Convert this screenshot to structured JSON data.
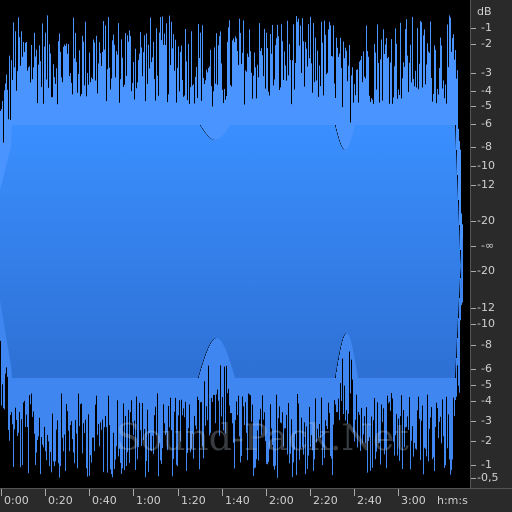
{
  "colors": {
    "waveform_top": "#3a8fff",
    "waveform_bottom": "#2e72d8",
    "waveform_peaks": "#4a94ff",
    "background": "#000000",
    "ruler_background": "#2a2a2a",
    "ruler_text": "#cfcfcf"
  },
  "db_ruler": {
    "unit": "dB",
    "labels": [
      "-1",
      "-2",
      "-3",
      "-4",
      "-5",
      "-6",
      "-8",
      "-10",
      "-12",
      "-20",
      "-∞",
      "-20",
      "-12",
      "-10",
      "-8",
      "-6",
      "-5",
      "-4",
      "-3",
      "-2",
      "-1",
      "-0,5"
    ]
  },
  "time_ruler": {
    "labels": [
      "0:00",
      "0:20",
      "0:40",
      "1:00",
      "1:20",
      "1:40",
      "2:00",
      "2:20",
      "2:40",
      "3:00"
    ],
    "unit": "h:m:s"
  },
  "watermark": "Sound-Pack.Net"
}
